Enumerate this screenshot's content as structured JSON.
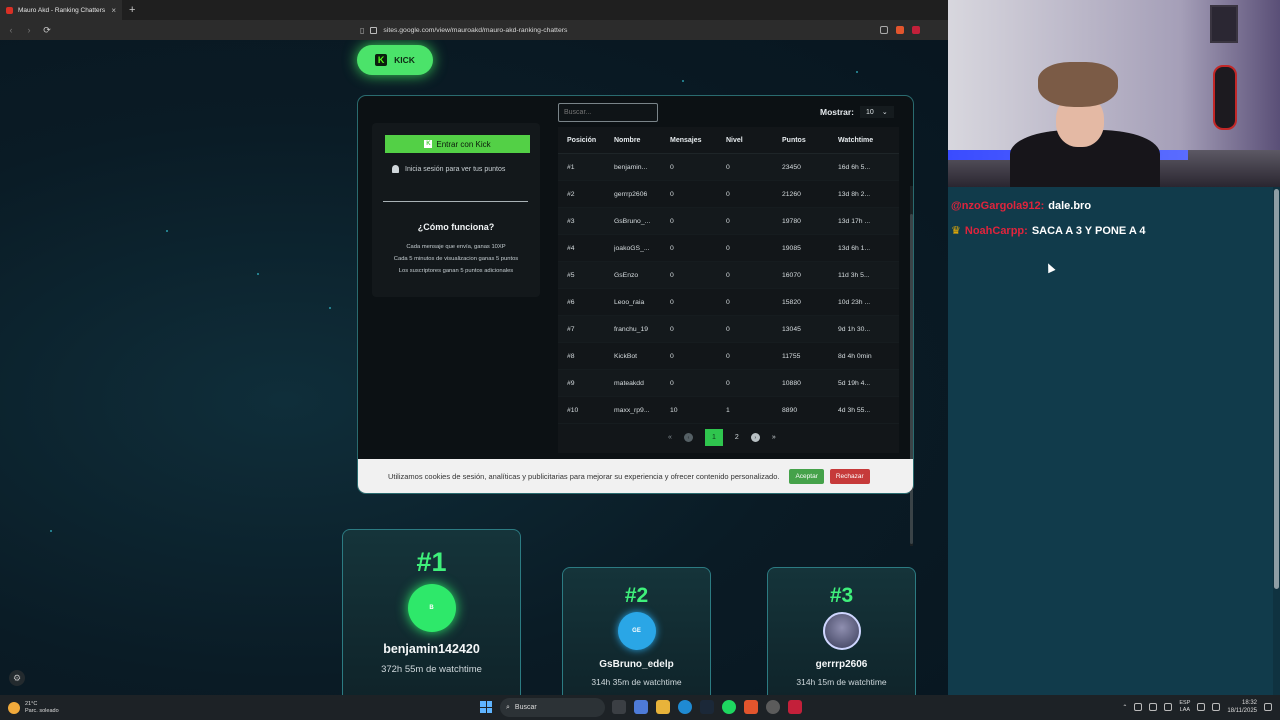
{
  "browser": {
    "tab_title": "Mauro Akd - Ranking Chatters",
    "tab_close": "×",
    "new_tab": "+",
    "url": "sites.google.com/view/mauroakd/mauro-akd-ranking-chatters"
  },
  "page": {
    "kick_button": "KICK",
    "login": {
      "button": "Entrar con Kick",
      "hint": "Inicia sesión para ver tus puntos",
      "how_title": "¿Cómo funciona?",
      "rules": [
        "Cada mensaje que envía, ganas 10XP",
        "Cada 5 minutos de visualizacion ganas 5 puntos",
        "Los suscriptores ganan 5 puntos adicionales"
      ]
    },
    "search_placeholder": "Buscar...",
    "show_label": "Mostrar:",
    "show_value": "10",
    "columns": [
      "Posición",
      "Nombre",
      "Mensajes",
      "Nivel",
      "Puntos",
      "Watchtime"
    ],
    "rows": [
      [
        "#1",
        "benjamin...",
        "0",
        "0",
        "23450",
        "16d 6h 5..."
      ],
      [
        "#2",
        "gerrrp2606",
        "0",
        "0",
        "21260",
        "13d 8h 2..."
      ],
      [
        "#3",
        "GsBruno_...",
        "0",
        "0",
        "19780",
        "13d 17h ..."
      ],
      [
        "#4",
        "joakoGS_...",
        "0",
        "0",
        "19085",
        "13d 6h 1..."
      ],
      [
        "#5",
        "GsEnzo",
        "0",
        "0",
        "16070",
        "11d 3h 5..."
      ],
      [
        "#6",
        "Leoo_raia",
        "0",
        "0",
        "15820",
        "10d 23h ..."
      ],
      [
        "#7",
        "franchu_19",
        "0",
        "0",
        "13045",
        "9d 1h 30..."
      ],
      [
        "#8",
        "KickBot",
        "0",
        "0",
        "11755",
        "8d 4h 0min"
      ],
      [
        "#9",
        "mateakdd",
        "0",
        "0",
        "10880",
        "5d 19h 4..."
      ],
      [
        "#10",
        "maxx_rp9...",
        "10",
        "1",
        "8890",
        "4d 3h 55..."
      ]
    ],
    "pagination": {
      "first": "«",
      "prev": "‹",
      "current": "1",
      "next_page": "2",
      "next": "›",
      "last": "»"
    },
    "cookie": {
      "text": "Utilizamos cookies de sesión, analíticas y publicitarias para mejorar su experiencia y ofrecer contenido personalizado.",
      "accept": "Aceptar",
      "reject": "Rechazar"
    },
    "podium": [
      {
        "rank": "#1",
        "name": "benjamin142420",
        "watchtime": "372h 55m de watchtime",
        "avatar_text": "B",
        "color": "#2ee86a"
      },
      {
        "rank": "#2",
        "name": "GsBruno_edelp",
        "watchtime": "314h 35m de watchtime",
        "avatar_text": "GE",
        "color": "#2aa6e6"
      },
      {
        "rank": "#3",
        "name": "gerrrp2606",
        "watchtime": "314h 15m de watchtime",
        "avatar_text": "",
        "color": "#5b5d8a"
      }
    ]
  },
  "chat": {
    "messages": [
      {
        "user": "@nzoGargola912:",
        "text": "dale.bro",
        "crown": false
      },
      {
        "user": "NoahCarpp:",
        "text": "SACA A 3 Y PONE A 4",
        "crown": true
      }
    ]
  },
  "taskbar": {
    "temp": "21°C",
    "weather": "Parc. soleado",
    "search": "Buscar",
    "lang_top": "ESP",
    "lang_bottom": "LAA",
    "time": "18:32",
    "date": "18/11/2025"
  }
}
